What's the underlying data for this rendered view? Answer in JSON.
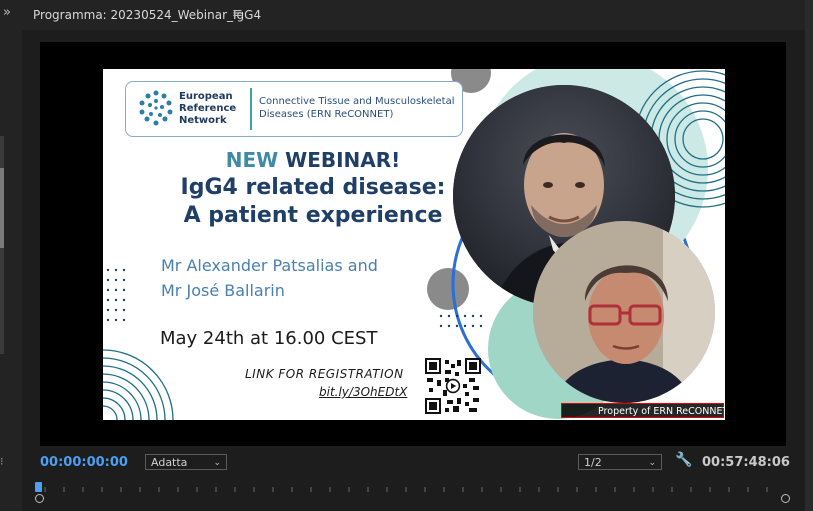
{
  "panel": {
    "title": "Programma: 20230524_Webinar_IgG4",
    "expander_icon": "double-chevron-right-icon",
    "menu_icon": "hamburger-menu-icon"
  },
  "slide": {
    "ern_title": [
      "European",
      "Reference",
      "Network"
    ],
    "ern_subtitle": [
      "Connective Tissue and Musculoskeletal",
      "Diseases (ERN ReCONNET)"
    ],
    "headline_new": "NEW",
    "headline_webinar": "WEBINAR!",
    "headline_line2": "IgG4 related disease:",
    "headline_line3": "A patient experience",
    "speaker_line1": "Mr Alexander Patsalias and",
    "speaker_line2": "Mr José Ballarin",
    "datetime": "May 24th at 16.00 CEST",
    "registration_label": "LINK FOR REGISTRATION",
    "registration_link": "bit.ly/3OhEDtX",
    "watermark": "Property of ERN ReCONNET"
  },
  "controls": {
    "timecode_current": "00:00:00:00",
    "zoom_value": "Adatta",
    "resolution_value": "1/2",
    "timecode_duration": "00:57:48:06",
    "wrench_icon": "wrench-icon"
  },
  "colors": {
    "accent_blue": "#4c9ff2",
    "slide_navy": "#1f3f66",
    "slide_teal": "#3e8aa8",
    "watermark_border": "#ee0000"
  }
}
